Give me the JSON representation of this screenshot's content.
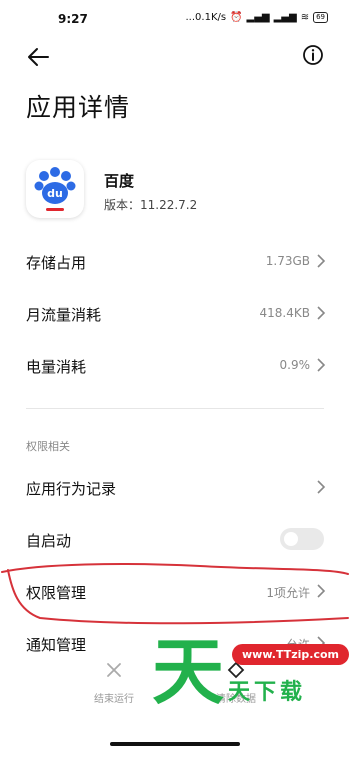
{
  "status_bar": {
    "time": "9:27",
    "net_speed": "...0.1K/s",
    "battery": "69"
  },
  "header": {
    "back_icon": "arrow-left-icon",
    "info_icon": "info-circle-icon",
    "title": "应用详情"
  },
  "app": {
    "name": "百度",
    "version": "版本：11.22.7.2",
    "icon_text": "du"
  },
  "rows": [
    {
      "label": "存储占用",
      "value": "1.73GB"
    },
    {
      "label": "月流量消耗",
      "value": "418.4KB"
    },
    {
      "label": "电量消耗",
      "value": "0.9%"
    }
  ],
  "permissions": {
    "section_label": "权限相关",
    "behavior_record": {
      "label": "应用行为记录"
    },
    "autostart": {
      "label": "自启动",
      "enabled": false
    },
    "permission_manage": {
      "label": "权限管理",
      "value": "1项允许"
    },
    "notification_manage": {
      "label": "通知管理",
      "value": "允许"
    }
  },
  "bottom": {
    "end_run": "结束运行",
    "clear_data": "清除数据"
  },
  "watermark": {
    "big_char": "天",
    "url": "www.TTzip.com",
    "text": "天下载"
  },
  "colors": {
    "annotation_red": "#d6323a",
    "watermark_green": "#22b14c",
    "baidu_blue": "#2d6be5"
  }
}
